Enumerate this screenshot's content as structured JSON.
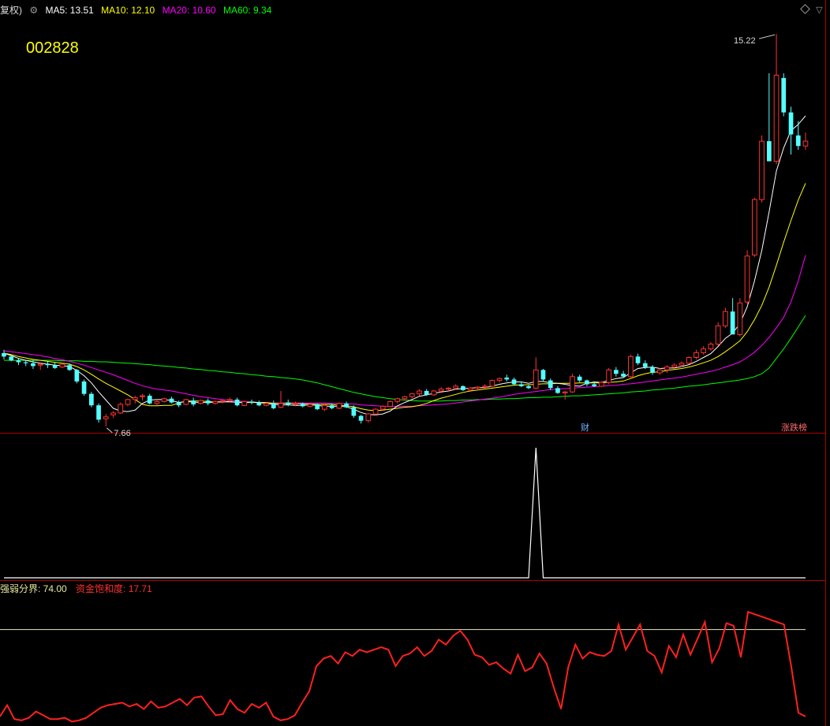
{
  "header": {
    "adj_label": "复权)",
    "ma5_label": "MA5: 13.51",
    "ma10_label": "MA10: 12.10",
    "ma20_label": "MA20: 10.60",
    "ma60_label": "MA60: 9.34"
  },
  "stock_code": "002828",
  "indicator_header": {
    "threshold_label": "强弱分界: 74.00",
    "saturation_label": "资金饱和度: 17.71"
  },
  "events": {
    "fin_label": "财",
    "rise_label": "涨跌榜"
  },
  "annotations": {
    "high_label": "15.22",
    "low_label": "7.66"
  },
  "colors": {
    "up": "#ff3232",
    "down": "#54ffff",
    "ma5": "#ffffff",
    "ma10": "#ffff00",
    "ma20": "#ff00ff",
    "ma60": "#00ff00",
    "saturation": "#ff2020",
    "threshold": "#e8e8c0",
    "panel_border": "#b00000"
  },
  "chart_data": [
    {
      "type": "candlestick",
      "name": "price",
      "ylim": [
        7.2,
        15.6
      ],
      "ohlc": [
        [
          8.55,
          8.62,
          8.42,
          8.48
        ],
        [
          8.48,
          8.5,
          8.38,
          8.4
        ],
        [
          8.4,
          8.45,
          8.3,
          8.36
        ],
        [
          8.36,
          8.4,
          8.28,
          8.34
        ],
        [
          8.34,
          8.4,
          8.22,
          8.28
        ],
        [
          8.3,
          8.36,
          8.2,
          8.32
        ],
        [
          8.33,
          8.38,
          8.24,
          8.3
        ],
        [
          8.3,
          8.36,
          8.22,
          8.24
        ],
        [
          8.26,
          8.34,
          8.24,
          8.32
        ],
        [
          8.3,
          8.34,
          8.18,
          8.2
        ],
        [
          8.2,
          8.22,
          7.92,
          7.96
        ],
        [
          7.96,
          8.0,
          7.66,
          7.7
        ],
        [
          7.7,
          7.74,
          7.42,
          7.46
        ],
        [
          7.46,
          7.5,
          7.1,
          7.16
        ],
        [
          7.18,
          7.28,
          7.02,
          7.22
        ],
        [
          7.26,
          7.34,
          7.2,
          7.3
        ],
        [
          7.3,
          7.52,
          7.28,
          7.48
        ],
        [
          7.48,
          7.6,
          7.44,
          7.58
        ],
        [
          7.58,
          7.66,
          7.5,
          7.62
        ],
        [
          7.64,
          7.7,
          7.56,
          7.66
        ],
        [
          7.66,
          7.7,
          7.48,
          7.5
        ],
        [
          7.5,
          7.58,
          7.46,
          7.54
        ],
        [
          7.54,
          7.62,
          7.52,
          7.6
        ],
        [
          7.6,
          7.64,
          7.5,
          7.52
        ],
        [
          7.52,
          7.56,
          7.42,
          7.46
        ],
        [
          7.48,
          7.6,
          7.46,
          7.58
        ],
        [
          7.56,
          7.62,
          7.44,
          7.48
        ],
        [
          7.5,
          7.58,
          7.48,
          7.56
        ],
        [
          7.56,
          7.6,
          7.46,
          7.5
        ],
        [
          7.5,
          7.56,
          7.48,
          7.54
        ],
        [
          7.54,
          7.58,
          7.5,
          7.56
        ],
        [
          7.56,
          7.62,
          7.52,
          7.58
        ],
        [
          7.58,
          7.62,
          7.44,
          7.46
        ],
        [
          7.46,
          7.56,
          7.44,
          7.54
        ],
        [
          7.54,
          7.58,
          7.48,
          7.52
        ],
        [
          7.52,
          7.56,
          7.44,
          7.46
        ],
        [
          7.46,
          7.52,
          7.44,
          7.5
        ],
        [
          7.5,
          7.56,
          7.38,
          7.4
        ],
        [
          7.42,
          7.76,
          7.4,
          7.5
        ],
        [
          7.52,
          7.58,
          7.44,
          7.48
        ],
        [
          7.48,
          7.54,
          7.44,
          7.5
        ],
        [
          7.5,
          7.52,
          7.42,
          7.44
        ],
        [
          7.44,
          7.5,
          7.42,
          7.48
        ],
        [
          7.48,
          7.5,
          7.36,
          7.38
        ],
        [
          7.38,
          7.48,
          7.34,
          7.46
        ],
        [
          7.46,
          7.5,
          7.38,
          7.4
        ],
        [
          7.4,
          7.52,
          7.38,
          7.5
        ],
        [
          7.5,
          7.54,
          7.4,
          7.42
        ],
        [
          7.42,
          7.46,
          7.2,
          7.24
        ],
        [
          7.24,
          7.26,
          7.08,
          7.14
        ],
        [
          7.14,
          7.3,
          7.1,
          7.28
        ],
        [
          7.28,
          7.4,
          7.26,
          7.38
        ],
        [
          7.38,
          7.46,
          7.34,
          7.44
        ],
        [
          7.44,
          7.56,
          7.42,
          7.54
        ],
        [
          7.54,
          7.62,
          7.5,
          7.6
        ],
        [
          7.6,
          7.66,
          7.56,
          7.64
        ],
        [
          7.64,
          7.72,
          7.6,
          7.7
        ],
        [
          7.7,
          7.8,
          7.66,
          7.76
        ],
        [
          7.76,
          7.8,
          7.66,
          7.68
        ],
        [
          7.68,
          7.78,
          7.66,
          7.76
        ],
        [
          7.76,
          7.84,
          7.72,
          7.8
        ],
        [
          7.8,
          7.84,
          7.74,
          7.82
        ],
        [
          7.82,
          7.9,
          7.78,
          7.86
        ],
        [
          7.86,
          7.88,
          7.76,
          7.78
        ],
        [
          7.78,
          7.84,
          7.74,
          7.82
        ],
        [
          7.82,
          7.86,
          7.78,
          7.84
        ],
        [
          7.84,
          7.9,
          7.8,
          7.86
        ],
        [
          7.86,
          8.0,
          7.84,
          7.98
        ],
        [
          7.98,
          8.04,
          7.94,
          8.02
        ],
        [
          8.04,
          8.1,
          7.96,
          8.0
        ],
        [
          8.0,
          8.04,
          7.88,
          7.9
        ],
        [
          7.9,
          7.96,
          7.84,
          7.86
        ],
        [
          7.86,
          7.9,
          7.8,
          7.82
        ],
        [
          7.82,
          8.46,
          7.8,
          8.2
        ],
        [
          8.2,
          8.22,
          7.96,
          8.0
        ],
        [
          7.98,
          8.02,
          7.78,
          7.82
        ],
        [
          7.82,
          7.86,
          7.7,
          7.72
        ],
        [
          7.72,
          7.76,
          7.58,
          7.74
        ],
        [
          7.74,
          8.12,
          7.72,
          8.06
        ],
        [
          8.06,
          8.1,
          7.94,
          7.98
        ],
        [
          7.98,
          8.0,
          7.86,
          7.9
        ],
        [
          7.9,
          7.96,
          7.84,
          7.86
        ],
        [
          7.86,
          7.96,
          7.84,
          7.94
        ],
        [
          7.94,
          8.24,
          7.9,
          8.2
        ],
        [
          8.2,
          8.26,
          8.06,
          8.12
        ],
        [
          8.12,
          8.18,
          8.04,
          8.06
        ],
        [
          8.06,
          8.52,
          8.02,
          8.48
        ],
        [
          8.48,
          8.54,
          8.3,
          8.34
        ],
        [
          8.34,
          8.4,
          8.22,
          8.26
        ],
        [
          8.26,
          8.3,
          8.1,
          8.14
        ],
        [
          8.14,
          8.24,
          8.1,
          8.2
        ],
        [
          8.2,
          8.3,
          8.14,
          8.26
        ],
        [
          8.26,
          8.34,
          8.22,
          8.3
        ],
        [
          8.3,
          8.38,
          8.26,
          8.34
        ],
        [
          8.34,
          8.48,
          8.32,
          8.46
        ],
        [
          8.46,
          8.62,
          8.42,
          8.56
        ],
        [
          8.56,
          8.7,
          8.52,
          8.64
        ],
        [
          8.64,
          8.78,
          8.6,
          8.74
        ],
        [
          8.74,
          9.2,
          8.7,
          9.12
        ],
        [
          9.12,
          9.5,
          9.08,
          9.42
        ],
        [
          9.42,
          9.7,
          9.36,
          8.94
        ],
        [
          8.94,
          9.7,
          8.9,
          9.6
        ],
        [
          9.62,
          10.7,
          9.58,
          10.58
        ],
        [
          10.6,
          11.8,
          10.56,
          11.76
        ],
        [
          11.76,
          13.1,
          11.7,
          12.98
        ],
        [
          12.98,
          14.4,
          12.9,
          12.56
        ],
        [
          12.56,
          15.22,
          12.5,
          14.36
        ],
        [
          14.3,
          14.4,
          13.5,
          13.58
        ],
        [
          13.58,
          13.7,
          12.7,
          13.12
        ],
        [
          13.1,
          13.4,
          12.8,
          12.88
        ],
        [
          12.88,
          13.16,
          12.8,
          12.98
        ]
      ],
      "ma5": [
        8.55,
        8.5,
        8.44,
        8.4,
        8.37,
        8.34,
        8.32,
        8.3,
        8.29,
        8.27,
        8.19,
        8.08,
        7.93,
        7.74,
        7.57,
        7.4,
        7.34,
        7.33,
        7.36,
        7.5,
        7.57,
        7.58,
        7.58,
        7.56,
        7.52,
        7.54,
        7.53,
        7.52,
        7.52,
        7.53,
        7.53,
        7.54,
        7.52,
        7.52,
        7.53,
        7.52,
        7.5,
        7.48,
        7.47,
        7.47,
        7.46,
        7.46,
        7.47,
        7.46,
        7.44,
        7.44,
        7.44,
        7.43,
        7.38,
        7.31,
        7.27,
        7.26,
        7.28,
        7.34,
        7.45,
        7.52,
        7.58,
        7.65,
        7.68,
        7.71,
        7.74,
        7.76,
        7.8,
        7.81,
        7.82,
        7.83,
        7.83,
        7.86,
        7.9,
        7.93,
        7.95,
        7.95,
        7.92,
        7.96,
        7.96,
        7.93,
        7.92,
        7.9,
        7.87,
        7.86,
        7.92,
        7.95,
        7.94,
        7.98,
        8.02,
        8.04,
        8.14,
        8.23,
        8.25,
        8.26,
        8.23,
        8.24,
        8.24,
        8.27,
        8.31,
        8.38,
        8.46,
        8.54,
        8.69,
        8.86,
        8.97,
        9.17,
        9.52,
        10.06,
        10.7,
        11.5,
        12.36,
        12.84,
        13.2,
        13.33,
        13.51
      ],
      "ma10": [
        8.55,
        8.52,
        8.48,
        8.45,
        8.42,
        8.4,
        8.38,
        8.36,
        8.34,
        8.32,
        8.27,
        8.2,
        8.11,
        8.01,
        7.92,
        7.84,
        7.76,
        7.68,
        7.58,
        7.48,
        7.45,
        7.45,
        7.46,
        7.46,
        7.51,
        7.55,
        7.55,
        7.55,
        7.54,
        7.53,
        7.54,
        7.53,
        7.53,
        7.52,
        7.52,
        7.52,
        7.52,
        7.5,
        7.5,
        7.5,
        7.5,
        7.49,
        7.49,
        7.48,
        7.48,
        7.48,
        7.46,
        7.45,
        7.43,
        7.39,
        7.36,
        7.35,
        7.36,
        7.38,
        7.4,
        7.42,
        7.43,
        7.46,
        7.5,
        7.56,
        7.61,
        7.65,
        7.69,
        7.73,
        7.76,
        7.78,
        7.8,
        7.82,
        7.84,
        7.86,
        7.88,
        7.89,
        7.89,
        7.9,
        7.91,
        7.91,
        7.92,
        7.92,
        7.92,
        7.93,
        7.93,
        7.93,
        7.93,
        7.94,
        7.95,
        7.97,
        8.02,
        8.08,
        8.12,
        8.15,
        8.16,
        8.19,
        8.21,
        8.23,
        8.26,
        8.3,
        8.35,
        8.4,
        8.48,
        8.58,
        8.69,
        8.81,
        9.0,
        9.25,
        9.55,
        9.93,
        10.39,
        10.87,
        11.32,
        11.75,
        12.1
      ],
      "ma20": [
        8.6,
        8.58,
        8.56,
        8.54,
        8.52,
        8.5,
        8.47,
        8.44,
        8.41,
        8.38,
        8.34,
        8.3,
        8.25,
        8.2,
        8.15,
        8.1,
        8.04,
        7.98,
        7.92,
        7.87,
        7.83,
        7.8,
        7.78,
        7.76,
        7.73,
        7.7,
        7.67,
        7.64,
        7.62,
        7.6,
        7.58,
        7.56,
        7.55,
        7.54,
        7.53,
        7.52,
        7.52,
        7.51,
        7.51,
        7.51,
        7.51,
        7.51,
        7.51,
        7.51,
        7.51,
        7.5,
        7.5,
        7.49,
        7.49,
        7.47,
        7.46,
        7.45,
        7.44,
        7.44,
        7.44,
        7.44,
        7.44,
        7.45,
        7.46,
        7.47,
        7.48,
        7.49,
        7.51,
        7.53,
        7.55,
        7.57,
        7.59,
        7.61,
        7.63,
        7.66,
        7.69,
        7.71,
        7.73,
        7.75,
        7.77,
        7.79,
        7.8,
        7.81,
        7.82,
        7.83,
        7.84,
        7.85,
        7.86,
        7.87,
        7.88,
        7.9,
        7.91,
        7.93,
        7.95,
        7.97,
        7.99,
        8.01,
        8.03,
        8.05,
        8.08,
        8.11,
        8.14,
        8.17,
        8.21,
        8.26,
        8.31,
        8.37,
        8.46,
        8.57,
        8.71,
        8.88,
        9.08,
        9.3,
        9.62,
        10.06,
        10.6
      ],
      "ma60": [
        8.4,
        8.4,
        8.4,
        8.4,
        8.4,
        8.4,
        8.4,
        8.4,
        8.39,
        8.39,
        8.39,
        8.38,
        8.38,
        8.37,
        8.37,
        8.36,
        8.35,
        8.34,
        8.33,
        8.32,
        8.31,
        8.29,
        8.28,
        8.27,
        8.25,
        8.24,
        8.22,
        8.21,
        8.19,
        8.18,
        8.16,
        8.15,
        8.13,
        8.12,
        8.1,
        8.09,
        8.07,
        8.06,
        8.04,
        8.03,
        8.01,
        7.99,
        7.96,
        7.93,
        7.89,
        7.85,
        7.81,
        7.77,
        7.73,
        7.7,
        7.67,
        7.64,
        7.62,
        7.6,
        7.58,
        7.57,
        7.56,
        7.55,
        7.55,
        7.55,
        7.55,
        7.56,
        7.56,
        7.57,
        7.57,
        7.58,
        7.58,
        7.59,
        7.59,
        7.6,
        7.6,
        7.61,
        7.62,
        7.62,
        7.63,
        7.63,
        7.64,
        7.65,
        7.66,
        7.66,
        7.67,
        7.68,
        7.69,
        7.7,
        7.71,
        7.72,
        7.74,
        7.75,
        7.76,
        7.78,
        7.79,
        7.81,
        7.82,
        7.84,
        7.86,
        7.87,
        7.89,
        7.91,
        7.93,
        7.95,
        7.97,
        7.99,
        8.02,
        8.06,
        8.12,
        8.24,
        8.44,
        8.64,
        8.86,
        9.1,
        9.34
      ]
    },
    {
      "type": "line",
      "name": "spike-indicator",
      "ylim": [
        0,
        1
      ],
      "values": [
        0,
        0,
        0,
        0,
        0,
        0,
        0,
        0,
        0,
        0,
        0,
        0,
        0,
        0,
        0,
        0,
        0,
        0,
        0,
        0,
        0,
        0,
        0,
        0,
        0,
        0,
        0,
        0,
        0,
        0,
        0,
        0,
        0,
        0,
        0,
        0,
        0,
        0,
        0,
        0,
        0,
        0,
        0,
        0,
        0,
        0,
        0,
        0,
        0,
        0,
        0,
        0,
        0,
        0,
        0,
        0,
        0,
        0,
        0,
        0,
        0,
        0,
        0,
        0,
        0,
        0,
        0,
        0,
        0,
        0,
        0,
        0,
        0,
        1,
        0,
        0,
        0,
        0,
        0,
        0,
        0,
        0,
        0,
        0,
        0,
        0,
        0,
        0,
        0,
        0,
        0,
        0,
        0,
        0,
        0,
        0,
        0,
        0,
        0,
        0,
        0,
        0,
        0,
        0,
        0,
        0,
        0,
        0,
        0,
        0,
        0
      ]
    },
    {
      "type": "line",
      "name": "资金饱和度",
      "ylim": [
        0,
        100
      ],
      "threshold": 74.0,
      "values": [
        5,
        14,
        3,
        2,
        4,
        9,
        6,
        3,
        3,
        4,
        1,
        2,
        4,
        8,
        12,
        14,
        15,
        16,
        13,
        15,
        11,
        17,
        12,
        13,
        16,
        19,
        14,
        20,
        21,
        13,
        6,
        7,
        18,
        11,
        8,
        15,
        12,
        16,
        5,
        2,
        3,
        6,
        16,
        25,
        45,
        51,
        53,
        47,
        56,
        53,
        58,
        56,
        58,
        60,
        58,
        45,
        53,
        55,
        60,
        53,
        57,
        66,
        62,
        69,
        73,
        66,
        54,
        52,
        46,
        48,
        43,
        39,
        54,
        41,
        44,
        55,
        47,
        28,
        11,
        44,
        62,
        51,
        56,
        54,
        53,
        57,
        78,
        58,
        68,
        78,
        57,
        53,
        40,
        61,
        52,
        70,
        54,
        67,
        80,
        48,
        59,
        79,
        77,
        52,
        88,
        86,
        84,
        82,
        80,
        78,
        45,
        8,
        5
      ]
    }
  ]
}
